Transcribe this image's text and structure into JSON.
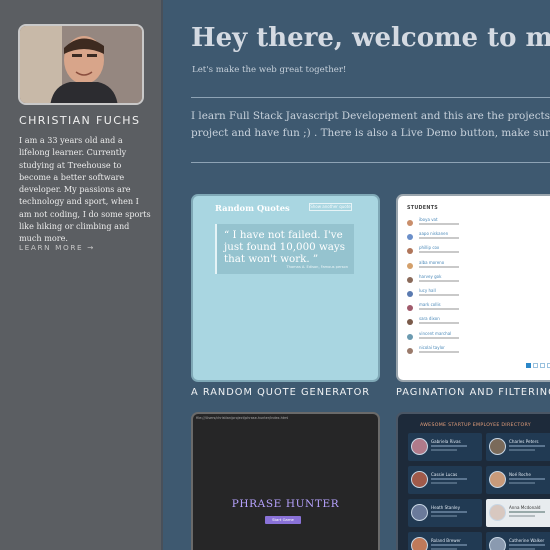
{
  "profile": {
    "name": "CHRISTIAN FUCHS",
    "bio": "I am a 33 years old and a lifelong learner. Currently studying at Treehouse to become a better software developer. My passions are technology and sport, when I am not coding, I do some sports like hiking or climbing and much more.",
    "learn_more": "LEARN MORE →"
  },
  "main": {
    "headline": "Hey there, welcome to my P",
    "tagline": "Let's make the web great together!",
    "intro_line1": "I learn Full Stack Javascript Developement and this are the projects I m",
    "intro_line2": "project and have fun ;) . There is also a Live Demo button, make sure t"
  },
  "projects": [
    {
      "label": "A RANDOM QUOTE GENERATOR",
      "preview": {
        "title": "Random Quotes",
        "button": "Show another quote",
        "quote": "I have not failed. I've just found 10,000 ways that won't work.",
        "author": "Thomas A. Edison, Famous person"
      }
    },
    {
      "label": "PAGINATION AND FILTERING",
      "preview": {
        "heading": "STUDENTS",
        "students": [
          "iboya vat",
          "aapo niskanen",
          "phillip cox",
          "alba moreno",
          "harvey gok",
          "lucy hall",
          "mark collis",
          "sara dixon",
          "vincent marchal",
          "nicolai taylor"
        ],
        "pages": [
          "1",
          "2",
          "3",
          "4",
          "5"
        ]
      }
    },
    {
      "label": "",
      "preview": {
        "top_text": "file:///Users/christian/project/phrase-hunter/index.html",
        "title": "PHRASE HUNTER",
        "button": "Start Game"
      }
    },
    {
      "label": "",
      "preview": {
        "heading": "AWESOME STARTUP EMPLOYEE DIRECTORY",
        "employees": [
          "Gabriela Rivas",
          "Charles Peters",
          "Cassie Lucas",
          "Noé Roche",
          "Heath Stanley",
          "Anna Mcdonald",
          "Roland Brewer",
          "Catherine Walker"
        ]
      }
    }
  ],
  "colors": {
    "sidebar": "#5b5e62",
    "main_bg": "#3e5970",
    "quote_card": "#a9d6e1",
    "phrase_accent": "#b7a3ff",
    "directory_accent": "#e6a07c"
  }
}
